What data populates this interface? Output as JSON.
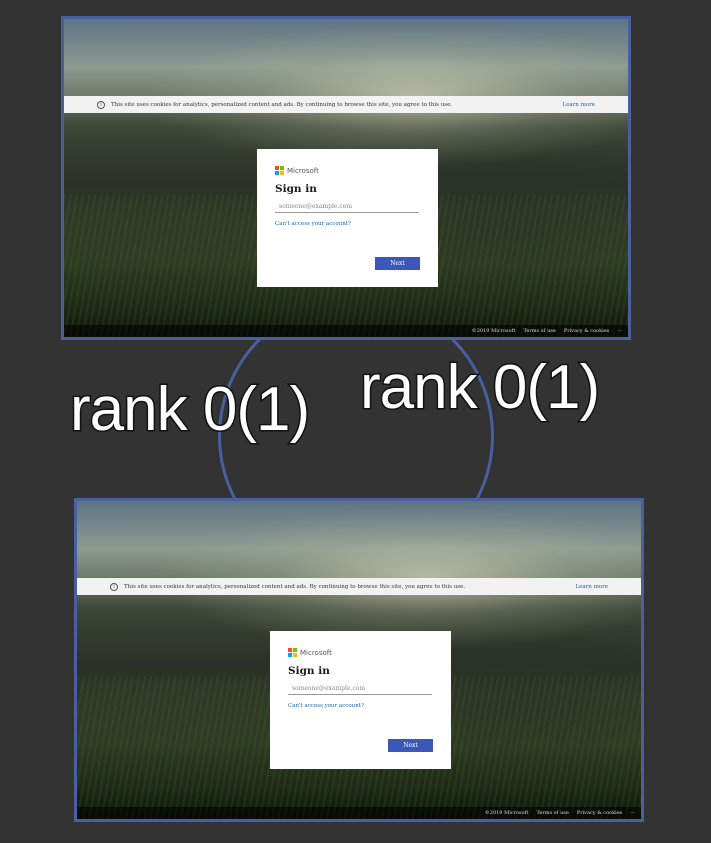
{
  "overlay_text": [
    "rank 0(1)",
    "rank 0(1)"
  ],
  "screens": [
    {
      "cookie_banner": {
        "text": "This site uses cookies for analytics, personalized content and ads. By continuing to browse this site, you agree to this use.",
        "link": "Learn more",
        "icon": "info-icon"
      },
      "signin": {
        "brand": "Microsoft",
        "title": "Sign in",
        "email_placeholder": "someone@example.com",
        "email_value": "",
        "help_link": "Can't access your account?",
        "next_label": "Next"
      },
      "footer": {
        "copyright": "©2019 Microsoft",
        "terms": "Terms of use",
        "privacy": "Privacy & cookies",
        "more": "···"
      }
    },
    {
      "cookie_banner": {
        "text": "This site uses cookies for analytics, personalized content and ads. By continuing to browse this site, you agree to this use.",
        "link": "Learn more",
        "icon": "info-icon"
      },
      "signin": {
        "brand": "Microsoft",
        "title": "Sign in",
        "email_placeholder": "someone@example.com",
        "email_value": "",
        "help_link": "Can't access your account?",
        "next_label": "Next"
      },
      "footer": {
        "copyright": "©2019 Microsoft",
        "terms": "Terms of use",
        "privacy": "Privacy & cookies",
        "more": "···"
      }
    }
  ],
  "colors": {
    "frame_border": "#4a5fa0",
    "next_button": "#3b57b8",
    "link": "#1a5fb4",
    "logo": [
      "#f25022",
      "#7fba00",
      "#00a4ef",
      "#ffb900"
    ]
  }
}
